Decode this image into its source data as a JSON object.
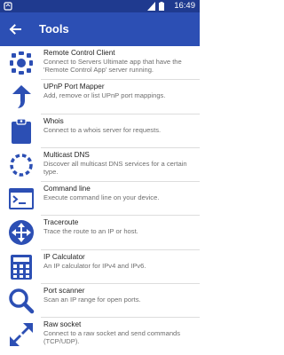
{
  "status_bar": {
    "time": "16:49"
  },
  "app_bar": {
    "title": "Tools"
  },
  "colors": {
    "status_bar": "#1f3a8f",
    "app_bar": "#2c4fb4",
    "icon": "#2c4fb4"
  },
  "tools": [
    {
      "name": "Remote Control Client",
      "description": "Connect to Servers Ultimate app that have the 'Remote Control App' server running.",
      "icon": "remote-control-icon"
    },
    {
      "name": "UPnP Port Mapper",
      "description": "Add, remove or list UPnP port mappings.",
      "icon": "upnp-arrow-icon"
    },
    {
      "name": "Whois",
      "description": "Connect to a whois server for requests.",
      "icon": "clipboard-icon"
    },
    {
      "name": "Multicast DNS",
      "description": "Discover all multicast DNS services for a certain type.",
      "icon": "multicast-circle-icon"
    },
    {
      "name": "Command line",
      "description": "Execute command line on your device.",
      "icon": "terminal-icon"
    },
    {
      "name": "Traceroute",
      "description": "Trace the route to an IP or host.",
      "icon": "move-arrows-icon"
    },
    {
      "name": "IP Calculator",
      "description": "An IP calculator for IPv4 and IPv6.",
      "icon": "calculator-icon"
    },
    {
      "name": "Port scanner",
      "description": "Scan an IP range for open ports.",
      "icon": "magnifier-icon"
    },
    {
      "name": "Raw socket",
      "description": "Connect to a raw socket and send commands (TCP/UDP).",
      "icon": "diagonal-arrows-icon"
    }
  ]
}
